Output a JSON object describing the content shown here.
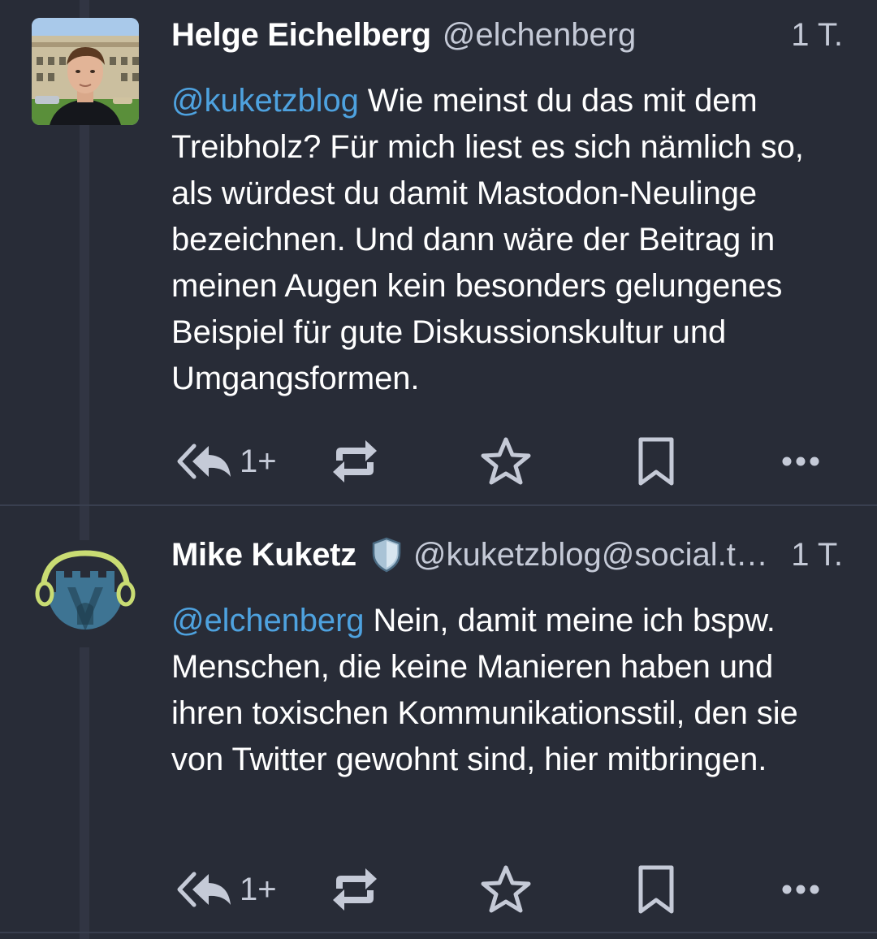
{
  "statuses": [
    {
      "display_name": "Helge Eichelberg",
      "acct": "@elchenberg",
      "time": "1 T.",
      "mention": "@kuketzblog",
      "text": " Wie meinst du das mit dem Treibholz? Für mich liest es sich nämlich so, als würdest du damit Mastodon-Neulinge bezeichnen. Und dann wäre der Beitrag in meinen Augen kein besonders gelungenes Beispiel für gute Diskussionskultur und Umgangsformen.",
      "reply_count": "1+",
      "avatar": "photo-avatar"
    },
    {
      "display_name": "Mike Kuketz",
      "badge_icon": "shield-icon",
      "acct": "@kuketzblog@social.tchncs.de",
      "time": "1 T.",
      "mention": "@elchenberg",
      "text": " Nein, damit meine ich bspw. Menschen, die keine Manieren haben und ihren toxischen Kommunikationsstil, den sie von Twitter gewohnt sind, hier mitbringen.",
      "reply_count": "1+",
      "avatar": "castle-headphones-logo"
    }
  ],
  "icons": {
    "reply": "reply-all-icon",
    "boost": "boost-icon",
    "favourite": "star-icon",
    "bookmark": "bookmark-icon",
    "more": "more-dots-icon"
  },
  "colors": {
    "background": "#282c37",
    "mention": "#4ea2df",
    "muted": "#c5cad7",
    "divider": "#393f4f"
  }
}
